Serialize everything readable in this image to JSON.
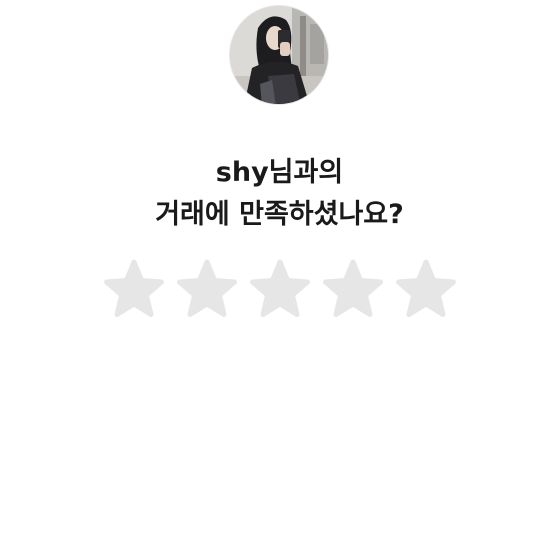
{
  "seller": {
    "name_line": "shy님과의"
  },
  "prompt": {
    "question_line": "거래에 만족하셨나요?"
  },
  "rating": {
    "max": 5,
    "selected": 0,
    "star_color_empty": "#e6e6e6"
  },
  "icons": {
    "star": "star-icon",
    "avatar": "profile-photo"
  }
}
